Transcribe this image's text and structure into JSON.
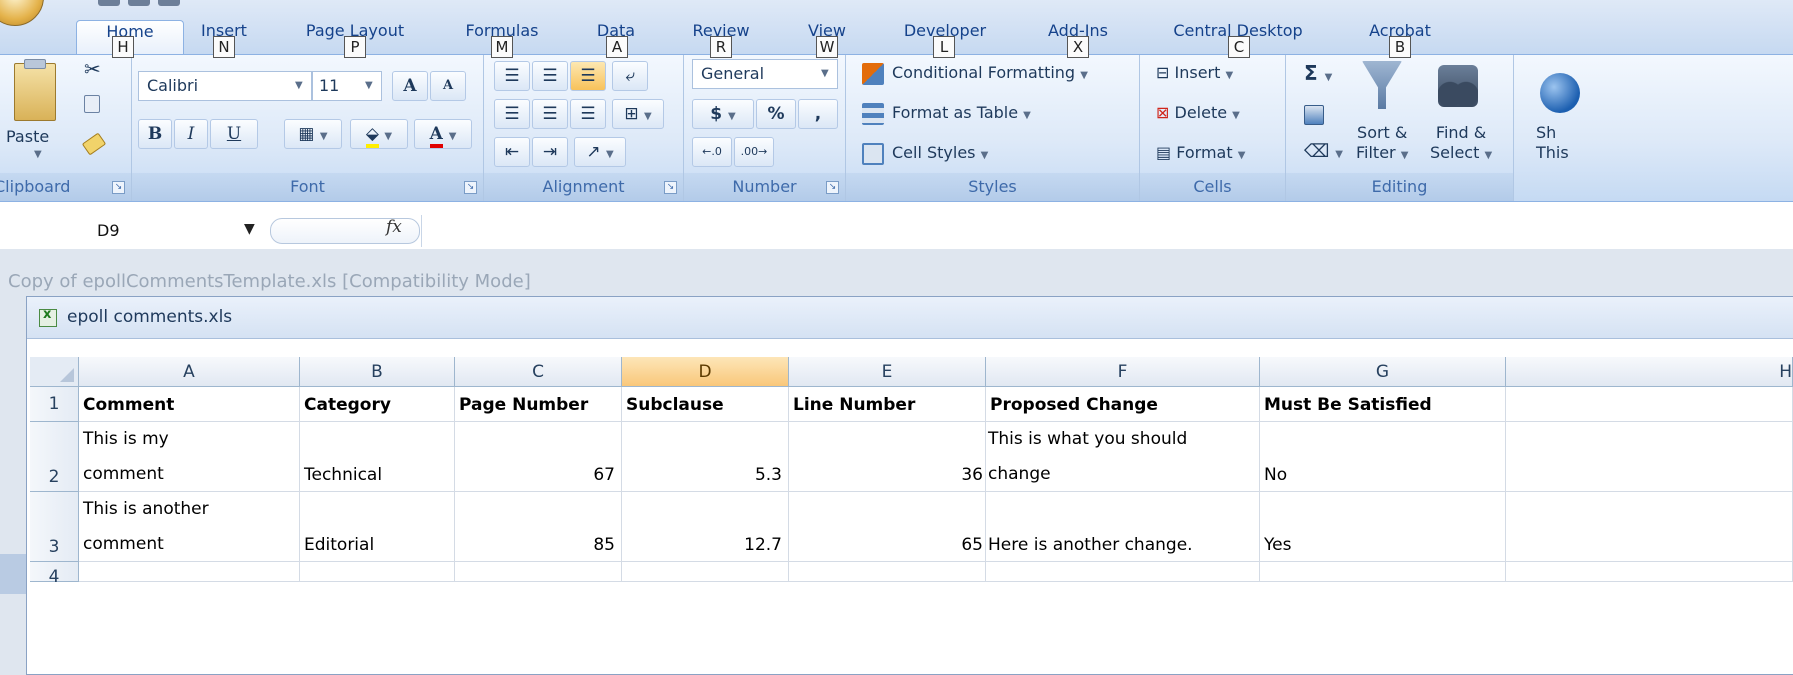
{
  "tabs": [
    {
      "label": "Home",
      "key": "H",
      "active": true
    },
    {
      "label": "Insert",
      "key": "N"
    },
    {
      "label": "Page Layout",
      "key": "P"
    },
    {
      "label": "Formulas",
      "key": "M"
    },
    {
      "label": "Data",
      "key": "A"
    },
    {
      "label": "Review",
      "key": "R"
    },
    {
      "label": "View",
      "key": "W"
    },
    {
      "label": "Developer",
      "key": "L"
    },
    {
      "label": "Add-Ins",
      "key": "X"
    },
    {
      "label": "Central Desktop",
      "key": "C"
    },
    {
      "label": "Acrobat",
      "key": "B"
    }
  ],
  "ribbon": {
    "clipboard": {
      "label": "Clipboard",
      "paste": "Paste"
    },
    "font": {
      "label": "Font",
      "name": "Calibri",
      "size": "11",
      "grow": "A",
      "shrink": "A",
      "bold": "B",
      "italic": "I",
      "underline": "U",
      "font_color_letter": "A"
    },
    "alignment": {
      "label": "Alignment"
    },
    "number": {
      "label": "Number",
      "format": "General",
      "currency": "$",
      "percent": "%",
      "comma": ","
    },
    "styles": {
      "label": "Styles",
      "conditional": "Conditional Formatting",
      "format_table": "Format as Table",
      "cell_styles": "Cell Styles"
    },
    "cells": {
      "label": "Cells",
      "insert": "Insert",
      "delete": "Delete",
      "format": "Format"
    },
    "editing": {
      "label": "Editing",
      "sigma": "Σ",
      "sort1": "Sort &",
      "sort2": "Filter",
      "find1": "Find &",
      "find2": "Select",
      "share1": "Sh",
      "share2": "This"
    }
  },
  "formula_bar": {
    "name_box": "D9",
    "fx": "fx",
    "content": ""
  },
  "workbook": {
    "app_title": "Copy of epollCommentsTemplate.xls  [Compatibility Mode]",
    "window_title": "epoll comments.xls"
  },
  "sheet": {
    "columns": [
      "A",
      "B",
      "C",
      "D",
      "E",
      "F",
      "G",
      "H"
    ],
    "selected_column": "D",
    "rows": [
      {
        "num": "1",
        "cells": [
          "Comment",
          "Category",
          "Page Number",
          "Subclause",
          "Line Number",
          "Proposed Change",
          "Must Be Satisfied"
        ]
      },
      {
        "num": "2",
        "cells": [
          "This is my|comment",
          "Technical",
          "67",
          "5.3",
          "36",
          "This is what you should|change",
          "No"
        ]
      },
      {
        "num": "3",
        "cells": [
          "This is another|comment",
          "Editorial",
          "85",
          "12.7",
          "65",
          "Here is another change.",
          "Yes"
        ]
      },
      {
        "num": "4",
        "cells": [
          "",
          "",
          "",
          "",
          "",
          "",
          ""
        ]
      }
    ]
  }
}
